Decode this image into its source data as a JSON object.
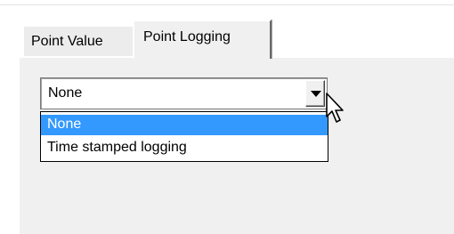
{
  "tabs": [
    {
      "label": "Point Value",
      "active": false
    },
    {
      "label": "Point Logging",
      "active": true
    }
  ],
  "logging_mode": {
    "selected": "None",
    "options": [
      "None",
      "Time stamped logging"
    ],
    "highlighted_option": "None"
  },
  "colors": {
    "selection_highlight": "#3399ff",
    "panel_background": "#f0f0f0"
  },
  "icons": {
    "dropdown_arrow": "chevron-down-icon",
    "cursor": "mouse-pointer-icon"
  }
}
